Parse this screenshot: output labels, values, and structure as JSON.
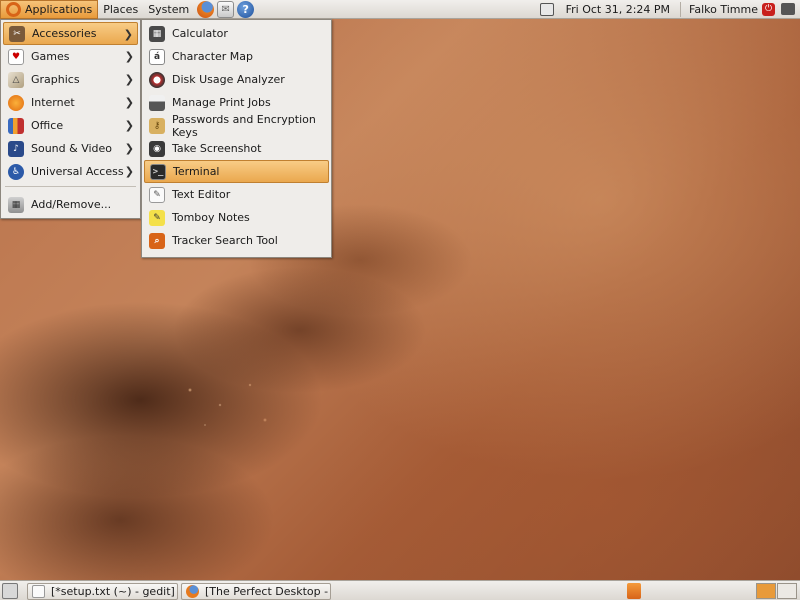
{
  "top_panel": {
    "menus": [
      {
        "label": "Applications",
        "active": true
      },
      {
        "label": "Places",
        "active": false
      },
      {
        "label": "System",
        "active": false
      }
    ],
    "launchers": [
      "firefox-icon",
      "mail-icon",
      "help-icon"
    ],
    "clock": "Fri Oct 31,  2:24 PM",
    "user": "Falko Timme"
  },
  "apps_menu": {
    "items": [
      {
        "label": "Accessories",
        "icon": "accessories-icon",
        "submenu": true,
        "highlighted": true
      },
      {
        "label": "Games",
        "icon": "games-icon",
        "submenu": true
      },
      {
        "label": "Graphics",
        "icon": "graphics-icon",
        "submenu": true
      },
      {
        "label": "Internet",
        "icon": "internet-icon",
        "submenu": true
      },
      {
        "label": "Office",
        "icon": "office-icon",
        "submenu": true
      },
      {
        "label": "Sound & Video",
        "icon": "sound-video-icon",
        "submenu": true
      },
      {
        "label": "Universal Access",
        "icon": "universal-access-icon",
        "submenu": true
      },
      {
        "label": "Add/Remove...",
        "icon": "add-remove-icon",
        "submenu": false
      }
    ]
  },
  "accessories_menu": {
    "items": [
      {
        "label": "Calculator",
        "icon": "calculator-icon"
      },
      {
        "label": "Character Map",
        "icon": "character-map-icon"
      },
      {
        "label": "Disk Usage Analyzer",
        "icon": "disk-usage-icon"
      },
      {
        "label": "Manage Print Jobs",
        "icon": "printer-icon"
      },
      {
        "label": "Passwords and Encryption Keys",
        "icon": "keys-icon"
      },
      {
        "label": "Take Screenshot",
        "icon": "camera-icon"
      },
      {
        "label": "Terminal",
        "icon": "terminal-icon",
        "highlighted": true
      },
      {
        "label": "Text Editor",
        "icon": "text-editor-icon"
      },
      {
        "label": "Tomboy Notes",
        "icon": "tomboy-notes-icon"
      },
      {
        "label": "Tracker Search Tool",
        "icon": "tracker-search-icon"
      }
    ]
  },
  "taskbar": {
    "tasks": [
      {
        "label": "[*setup.txt (~) - gedit]",
        "icon": "gedit-icon"
      },
      {
        "label": "[The Perfect Desktop - ...",
        "icon": "firefox-icon"
      }
    ]
  },
  "colors": {
    "highlight": "#eaa84e",
    "panel": "#dcd8d2",
    "wallpaper": "#b9714a"
  }
}
